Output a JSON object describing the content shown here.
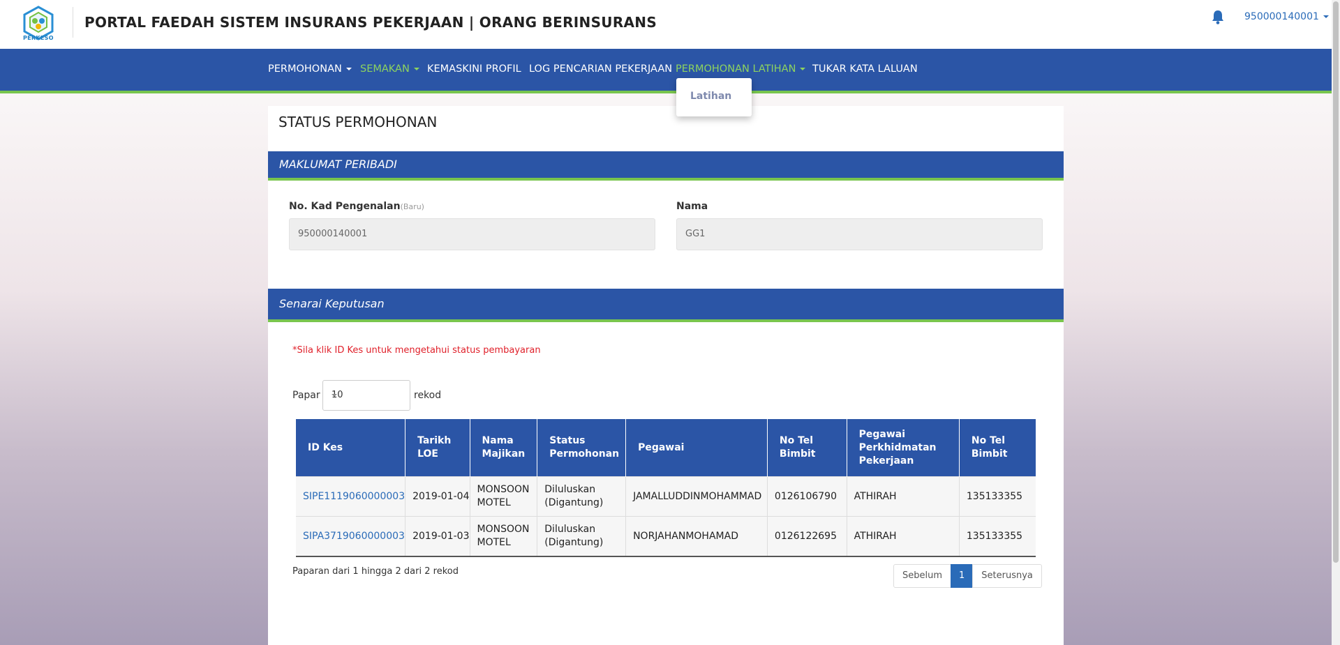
{
  "header": {
    "logo_text": "PERKESO",
    "title": "PORTAL FAEDAH SISTEM INSURANS PEKERJAAN | ORANG BERINSURANS",
    "user": "950000140001",
    "notification_icon": "bell-icon"
  },
  "nav": {
    "items": [
      {
        "label": "PERMOHONAN"
      },
      {
        "label": "SEMAKAN"
      },
      {
        "label": "KEMASKINI PROFIL"
      },
      {
        "label": "LOG PENCARIAN PEKERJAAN"
      },
      {
        "label": "PERMOHONAN LATIHAN"
      },
      {
        "label": "TUKAR KATA LALUAN"
      }
    ],
    "dropdown_item": "Latihan",
    "accent_color": "#8dd35f",
    "bar_color": "#2b55a6"
  },
  "page": {
    "title": "STATUS PERMOHONAN"
  },
  "personal": {
    "section_title": "MAKLUMAT PERIBADI",
    "ic_label": "No. Kad Pengenalan",
    "ic_sub": "(Baru)",
    "ic_value": "950000140001",
    "name_label": "Nama",
    "name_value": "GG1"
  },
  "decisions": {
    "section_title": "Senarai Keputusan",
    "note": "*Sila klik ID Kes untuk mengetahui status pembayaran",
    "show_label": "Papar",
    "show_value": "10",
    "records_label": "rekod",
    "columns": [
      "ID Kes",
      "Tarikh LOE",
      "Nama Majikan",
      "Status Permohonan",
      "Pegawai",
      "No Tel Bimbit",
      "Pegawai Perkhidmatan Pekerjaan",
      "No Tel Bimbit"
    ],
    "rows": [
      [
        "SIPE1119060000003",
        "2019-01-04",
        "MONSOON MOTEL",
        "Diluluskan (Digantung)",
        "JAMALLUDDINMOHAMMAD",
        "0126106790",
        "ATHIRAH",
        "135133355"
      ],
      [
        "SIPA3719060000003",
        "2019-01-03",
        "MONSOON MOTEL",
        "Diluluskan (Digantung)",
        "NORJAHANMOHAMAD",
        "0126122695",
        "ATHIRAH",
        "135133355"
      ]
    ],
    "info": "Paparan dari 1 hingga 2 dari 2 rekod",
    "pager": {
      "prev": "Sebelum",
      "current": "1",
      "next": "Seterusnya"
    }
  }
}
